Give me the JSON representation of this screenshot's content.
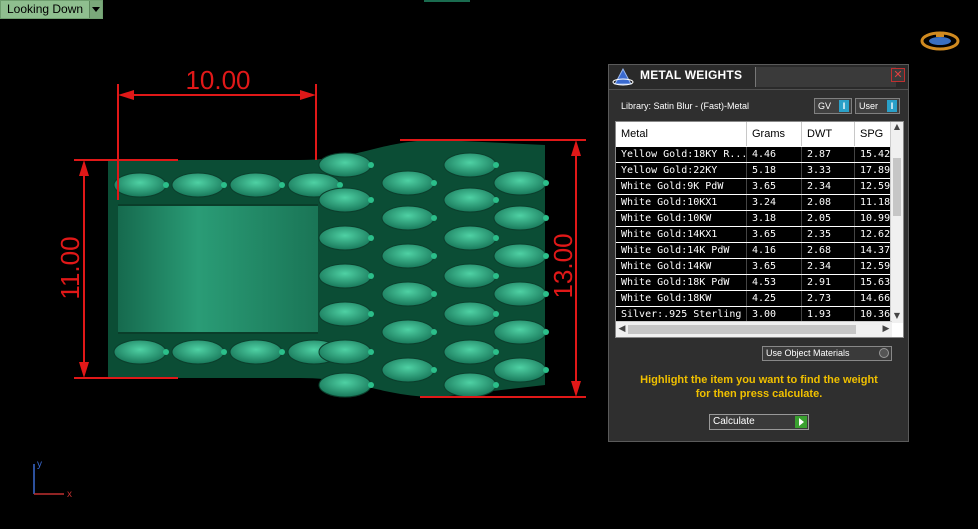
{
  "viewport": {
    "label": "Looking Down"
  },
  "dimensions": {
    "top": "10.00",
    "left": "11.00",
    "right": "13.00"
  },
  "axis": {
    "x_label": "x",
    "y_label": "y"
  },
  "panel": {
    "title": "METAL WEIGHTS",
    "close": "✕",
    "library": "Library: Satin Blur - (Fast)-Metal",
    "toggle_gv": "GV",
    "toggle_user": "User",
    "toggle_mark": "I",
    "columns": [
      "Metal",
      "Grams",
      "DWT",
      "SPG"
    ],
    "rows": [
      [
        "Yellow Gold:18KY R...",
        "4.46",
        "2.87",
        "15.42"
      ],
      [
        "Yellow Gold:22KY",
        "5.18",
        "3.33",
        "17.89"
      ],
      [
        "White Gold:9K PdW",
        "3.65",
        "2.34",
        "12.59"
      ],
      [
        "White Gold:10KX1",
        "3.24",
        "2.08",
        "11.18"
      ],
      [
        "White Gold:10KW",
        "3.18",
        "2.05",
        "10.99"
      ],
      [
        "White Gold:14KX1",
        "3.65",
        "2.35",
        "12.62"
      ],
      [
        "White Gold:14K PdW",
        "4.16",
        "2.68",
        "14.37"
      ],
      [
        "White Gold:14KW",
        "3.65",
        "2.34",
        "12.59"
      ],
      [
        "White Gold:18K PdW",
        "4.53",
        "2.91",
        "15.63"
      ],
      [
        "White Gold:18KW",
        "4.25",
        "2.73",
        "14.66"
      ],
      [
        "Silver:.925 Sterling",
        "3.00",
        "1.93",
        "10.36"
      ]
    ],
    "use_object_materials": "Use Object Materials",
    "hint_line1": "Highlight the item you want to find the weight",
    "hint_line2": "for then press calculate.",
    "calculate": "Calculate"
  },
  "colors": {
    "dimension": "#e01818",
    "ring": "#1f8a66",
    "hint": "#f0c000"
  }
}
